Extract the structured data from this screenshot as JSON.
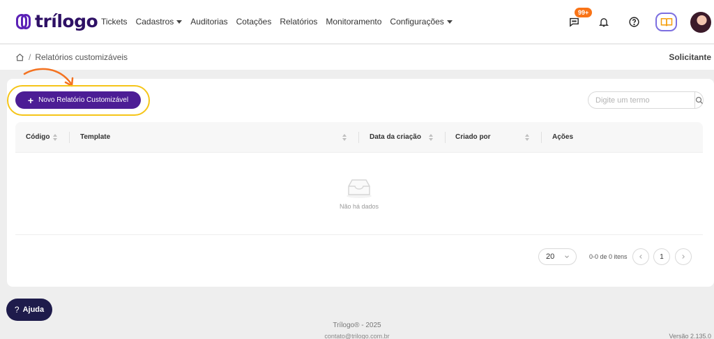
{
  "brand": {
    "name": "trílogo"
  },
  "nav": {
    "items": [
      {
        "label": "Tickets",
        "dropdown": false
      },
      {
        "label": "Cadastros",
        "dropdown": true
      },
      {
        "label": "Auditorias",
        "dropdown": false
      },
      {
        "label": "Cotações",
        "dropdown": false
      },
      {
        "label": "Relatórios",
        "dropdown": false
      },
      {
        "label": "Monitoramento",
        "dropdown": false
      },
      {
        "label": "Configurações",
        "dropdown": true
      }
    ]
  },
  "header_actions": {
    "chat_badge": "99+",
    "icons": [
      "chat-icon",
      "bell-icon",
      "help-circle-icon",
      "book-icon"
    ]
  },
  "breadcrumb": {
    "current": "Relatórios customizáveis"
  },
  "user": {
    "role": "Solicitante"
  },
  "toolbar": {
    "new_button_label": "Novo Relatório Customizável",
    "search_placeholder": "Digite um termo"
  },
  "table": {
    "columns": [
      "Código",
      "Template",
      "Data da criação",
      "Criado por",
      "Ações"
    ],
    "empty_text": "Não há dados"
  },
  "pagination": {
    "page_size": "20",
    "range_text": "0-0 de 0 itens",
    "current_page": "1"
  },
  "help_button": {
    "label": "Ajuda"
  },
  "footer": {
    "copyright": "Trílogo® - 2025",
    "contact": "contato@trilogo.com.br",
    "version": "Versão 2.135.0"
  },
  "colors": {
    "primary": "#4c1d95",
    "highlight": "#f5c518",
    "badge": "#f97316",
    "help_button": "#1e1b4b"
  }
}
